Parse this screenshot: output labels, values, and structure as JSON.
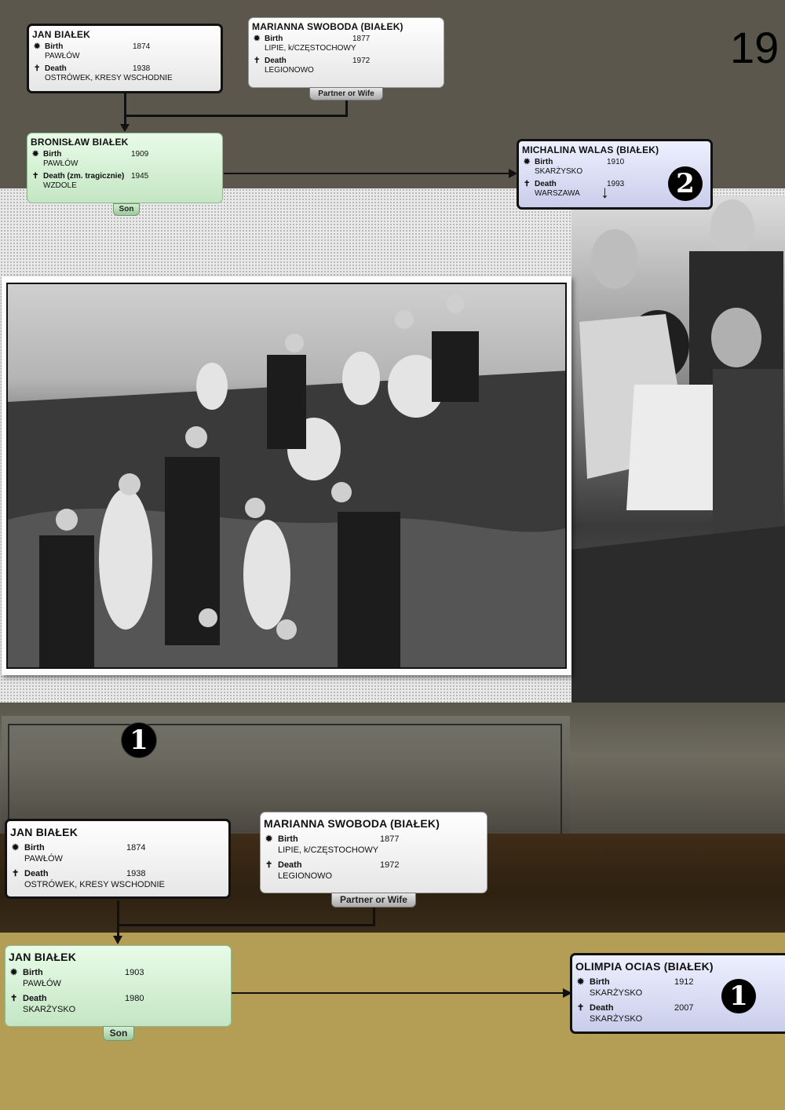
{
  "year_label": "19",
  "badges": {
    "one": "1",
    "two": "2"
  },
  "arrow_glyph": "↓",
  "icons": {
    "birth": "✹",
    "death": "✝"
  },
  "cards": {
    "jan_top": {
      "name": "JAN BIAŁEK",
      "birth_label": "Birth",
      "birth_year": "1874",
      "birth_place": "PAWŁÓW",
      "death_label": "Death",
      "death_year": "1938",
      "death_place": "OSTRÓWEK, KRESY WSCHODNIE"
    },
    "marianna_top": {
      "name": "MARIANNA SWOBODA (BIAŁEK)",
      "birth_label": "Birth",
      "birth_year": "1877",
      "birth_place": "LIPIE, k/CZĘSTOCHOWY",
      "death_label": "Death",
      "death_year": "1972",
      "death_place": "LEGIONOWO",
      "tag": "Partner or Wife"
    },
    "bronislaw": {
      "name": "BRONISŁAW BIAŁEK",
      "birth_label": "Birth",
      "birth_year": "1909",
      "birth_place": "PAWŁÓW",
      "death_label": "Death (zm. tragicznie)",
      "death_year": "1945",
      "death_place": "WZDOLE",
      "tag": "Son"
    },
    "michalina": {
      "name": "MICHALINA WALAS (BIAŁEK)",
      "birth_label": "Birth",
      "birth_year": "1910",
      "birth_place": "SKARŻYSKO",
      "death_label": "Death",
      "death_year": "1993",
      "death_place": "WARSZAWA"
    },
    "jan_bottom": {
      "name": "JAN BIAŁEK",
      "birth_label": "Birth",
      "birth_year": "1874",
      "birth_place": "PAWŁÓW",
      "death_label": "Death",
      "death_year": "1938",
      "death_place": "OSTRÓWEK, KRESY WSCHODNIE"
    },
    "marianna_bottom": {
      "name": "MARIANNA SWOBODA (BIAŁEK)",
      "birth_label": "Birth",
      "birth_year": "1877",
      "birth_place": "LIPIE, k/CZĘSTOCHOWY",
      "death_label": "Death",
      "death_year": "1972",
      "death_place": "LEGIONOWO",
      "tag": "Partner or Wife"
    },
    "jan_son": {
      "name": "JAN BIAŁEK",
      "birth_label": "Birth",
      "birth_year": "1903",
      "birth_place": "PAWŁÓW",
      "death_label": "Death",
      "death_year": "1980",
      "death_place": "SKARŻYSKO",
      "tag": "Son"
    },
    "olimpia": {
      "name": "OLIMPIA OCIAS (BIAŁEK)",
      "birth_label": "Birth",
      "birth_year": "1912",
      "birth_place": "SKARŻYSKO",
      "death_label": "Death",
      "death_year": "2007",
      "death_place": "SKARŻYSKO"
    }
  }
}
